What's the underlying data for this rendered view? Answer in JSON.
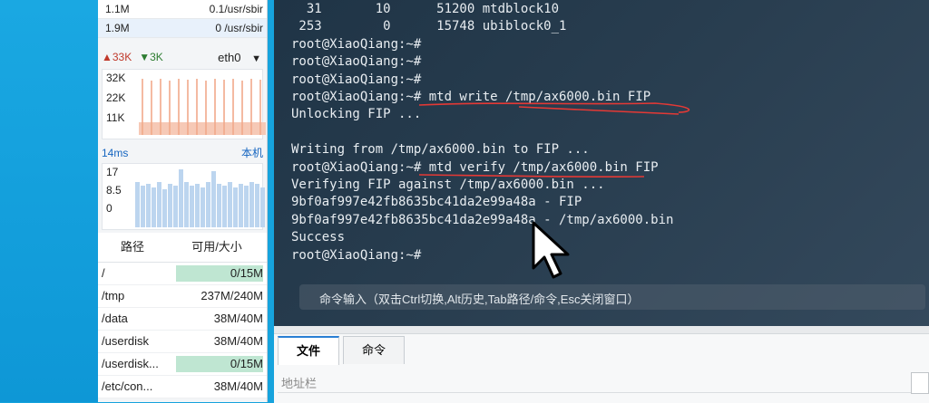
{
  "sysmon": {
    "top_rows": [
      {
        "a": "1.1M",
        "b": "0.1/usr/sbir"
      },
      {
        "a": "1.9M",
        "b": "0 /usr/sbir"
      }
    ],
    "network": {
      "up": "▲33K",
      "down": "▼3K",
      "interface": "eth0",
      "dropdown_glyph": "▼",
      "y_labels": [
        "32K",
        "22K",
        "11K"
      ]
    },
    "ping": {
      "latency": "14ms",
      "host": "本机",
      "y_labels": [
        "17",
        "8.5",
        "0"
      ]
    },
    "disk": {
      "headers": [
        "路径",
        "可用/大小"
      ],
      "rows": [
        {
          "path": "/",
          "size": "0/15M",
          "usage": 1.0
        },
        {
          "path": "/tmp",
          "size": "237M/240M",
          "usage": 0.0
        },
        {
          "path": "/data",
          "size": "38M/40M",
          "usage": 0.0
        },
        {
          "path": "/userdisk",
          "size": "38M/40M",
          "usage": 0.0
        },
        {
          "path": "/userdisk...",
          "size": "0/15M",
          "usage": 1.0
        },
        {
          "path": "/etc/con...",
          "size": "38M/40M",
          "usage": 0.0
        }
      ],
      "usage_color": "#bfe6d2"
    }
  },
  "terminal": {
    "lines": [
      "  31       10      51200 mtdblock10",
      " 253        0      15748 ubiblock0_1",
      "root@XiaoQiang:~#",
      "root@XiaoQiang:~#",
      "root@XiaoQiang:~#",
      "root@XiaoQiang:~# mtd write /tmp/ax6000.bin FIP",
      "Unlocking FIP ...",
      "",
      "Writing from /tmp/ax6000.bin to FIP ...",
      "root@XiaoQiang:~# mtd verify /tmp/ax6000.bin FIP",
      "Verifying FIP against /tmp/ax6000.bin ...",
      "9bf0af997e42fb8635bc41da2e99a48a - FIP",
      "9bf0af997e42fb8635bc41da2e99a48a - /tmp/ax6000.bin",
      "Success",
      "root@XiaoQiang:~#"
    ],
    "command_hint": "命令输入（双击Ctrl切换,Alt历史,Tab路径/命令,Esc关闭窗口）",
    "annotation_color": "#e53935"
  },
  "file_panel": {
    "tabs": [
      "文件",
      "命令"
    ],
    "address_label": "地址栏"
  }
}
